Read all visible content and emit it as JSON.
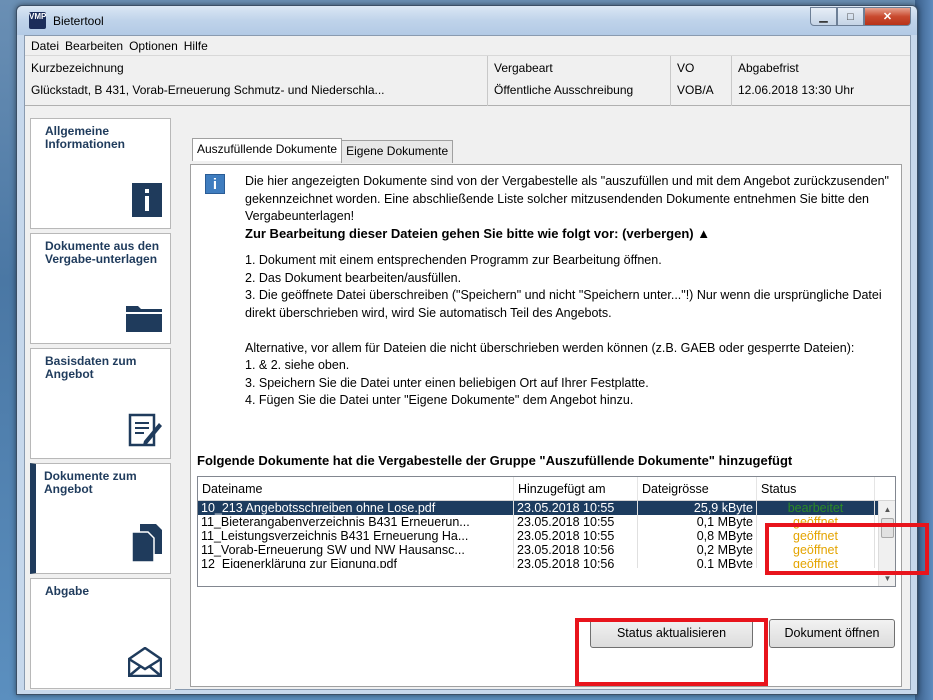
{
  "window": {
    "title": "Bietertool",
    "app_icon_text": "VMP"
  },
  "menu": [
    "Datei",
    "Bearbeiten",
    "Optionen",
    "Hilfe"
  ],
  "infobar": {
    "kurz_label": "Kurzbezeichnung",
    "kurz_value": "Glückstadt, B 431, Vorab-Erneuerung Schmutz- und Niederschla...",
    "vergabeart_label": "Vergabeart",
    "vergabeart_value": "Öffentliche Ausschreibung",
    "vo_label": "VO",
    "vo_value": "VOB/A",
    "abgabefrist_label": "Abgabefrist",
    "abgabefrist_value": "12.06.2018 13:30 Uhr"
  },
  "sidebar": {
    "items": [
      {
        "label": "Allgemeine Informationen",
        "icon": "info-icon"
      },
      {
        "label": "Dokumente aus den Vergabe-unterlagen",
        "icon": "folder-icon"
      },
      {
        "label": "Basisdaten zum Angebot",
        "icon": "edit-document-icon"
      },
      {
        "label": "Dokumente zum Angebot",
        "icon": "documents-icon"
      },
      {
        "label": "Abgabe",
        "icon": "envelope-icon"
      }
    ],
    "active_index": 3
  },
  "tabs": [
    "Auszufüllende Dokumente",
    "Eigene Dokumente"
  ],
  "panel": {
    "info_text": "Die hier angezeigten Dokumente sind von der Vergabestelle als \"auszufüllen und mit dem Angebot zurückzusenden\" gekennzeichnet worden. Eine abschließende Liste solcher mitzusendenden Dokumente entnehmen Sie bitte den Vergabeunterlagen!",
    "heading": "Zur Bearbeitung dieser Dateien gehen Sie bitte wie folgt vor: (verbergen) ▲",
    "steps": [
      "1. Dokument mit einem entsprechenden Programm zur Bearbeitung öffnen.",
      "2. Das Dokument bearbeiten/ausfüllen.",
      "3. Die geöffnete Datei überschreiben (\"Speichern\" und nicht \"Speichern unter...\"!) Nur wenn die ursprüngliche Datei direkt überschrieben wird, wird Sie automatisch Teil des Angebots.",
      "",
      "Alternative, vor allem für Dateien die nicht überschrieben werden können (z.B. GAEB oder gesperrte Dateien):",
      "1. & 2. siehe oben.",
      "3. Speichern Sie die Datei unter einen beliebigen Ort auf Ihrer Festplatte.",
      "4. Fügen Sie die Datei unter \"Eigene Dokumente\" dem Angebot hinzu."
    ],
    "table_heading": "Folgende Dokumente hat die Vergabestelle der Gruppe \"Auszufüllende Dokumente\" hinzugefügt"
  },
  "table": {
    "columns": [
      "Dateiname",
      "Hinzugefügt am",
      "Dateigrösse",
      "Status"
    ],
    "rows": [
      {
        "name": "10_213 Angebotsschreiben ohne Lose.pdf",
        "date": "23.05.2018 10:55",
        "size": "25,9 kByte",
        "status": "bearbeitet",
        "status_color": "#2a8a25"
      },
      {
        "name": "11_Bieterangabenverzeichnis B431 Erneuerun...",
        "date": "23.05.2018 10:55",
        "size": "0,1 MByte",
        "status": "geöffnet",
        "status_color": "#e4a400"
      },
      {
        "name": "11_Leistungsverzeichnis B431 Erneuerung Ha...",
        "date": "23.05.2018 10:55",
        "size": "0,8 MByte",
        "status": "geöffnet",
        "status_color": "#e4a400"
      },
      {
        "name": "11_Vorab-Erneuerung SW und NW Hausansc...",
        "date": "23.05.2018 10:56",
        "size": "0,2 MByte",
        "status": "geöffnet",
        "status_color": "#e4a400"
      },
      {
        "name": "12_Eigenerklärung zur Eignung.pdf",
        "date": "23.05.2018 10:56",
        "size": "0,1 MByte",
        "status": "geöffnet",
        "status_color": "#e4a400"
      }
    ],
    "selected_index": 0
  },
  "buttons": {
    "status_refresh": "Status aktualisieren",
    "open_document": "Dokument öffnen"
  },
  "colors": {
    "highlight": "#e8141c",
    "selection": "#1d3c5f",
    "accent": "#1f3b5c"
  }
}
